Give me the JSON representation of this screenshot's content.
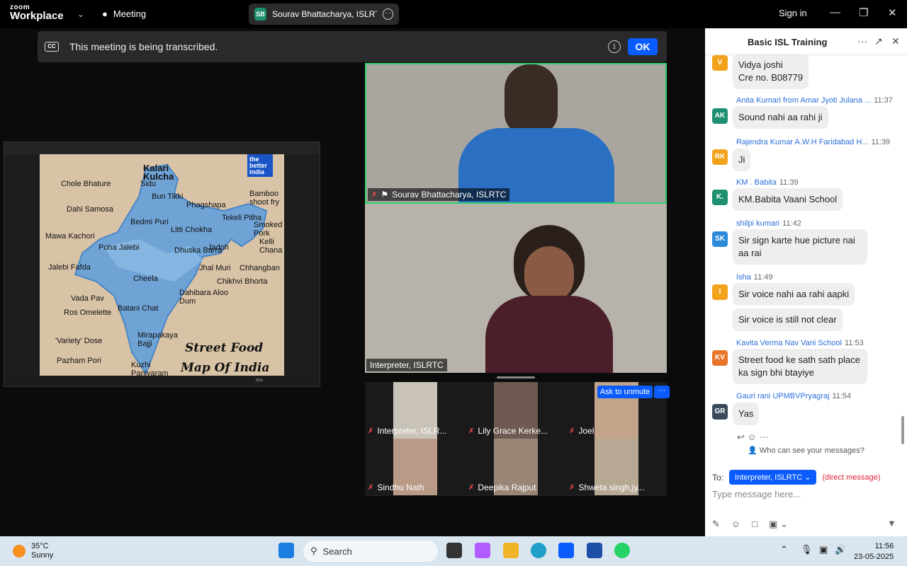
{
  "topbar": {
    "logo_top": "zoom",
    "logo_bottom": "Workplace",
    "meeting_label": "Meeting",
    "share_initials": "SB",
    "share_label": "Sourav Bhattacharya, ISLRTC's scr",
    "signin": "Sign in"
  },
  "banner": {
    "cc": "CC",
    "text": "This meeting is being transcribed.",
    "ok": "OK"
  },
  "shared_screen": {
    "brand": "the better india",
    "title_line1": "Street Food",
    "title_line2": "Map Of India",
    "labels": [
      "Kalari Kulcha",
      "Chole Bhature",
      "Sidu",
      "Bun Tikki",
      "Phagshapa",
      "Bamboo shoot fry",
      "Dahi Samosa",
      "Tekeli Pitha",
      "Smoked Pork",
      "Mawa Kachori",
      "Bedmi Puri",
      "Litti Chokha",
      "Kelli Chana",
      "Poha Jalebi",
      "Dhuska Barra",
      "Jadoh",
      "Jalebi Fafda",
      "Chhangban",
      "Jhal Muri",
      "Cheela",
      "Chikhvi Bhorta",
      "Dahibara Aloo Dum",
      "Vada Pav",
      "Batani Chat",
      "Ros Omelette",
      "Mirapakaya Bajji",
      "'Variety' Dose",
      "Pazham Pori",
      "Kuzhi Paniyaram"
    ],
    "zoom_pct": "55%"
  },
  "videos": {
    "main_top_name": "Sourav Bhattacharya, ISLRTC",
    "main_bottom_name": "Interpreter, ISLRTC"
  },
  "gallery": {
    "ask_unmute": "Ask to unmute",
    "more": "···",
    "tiles": [
      "Interpreter, ISLR...",
      "Lily Grace Kerke...",
      "Joel",
      "Sindhu Nath",
      "Deepika Rajput",
      "Shweta singh,jy..."
    ]
  },
  "chat": {
    "title": "Basic ISL Training",
    "messages": [
      {
        "initials": "V",
        "color": "#f2a31b",
        "sender": "",
        "time": "",
        "text": "Vidya joshi\nCre no. B08779"
      },
      {
        "initials": "AK",
        "color": "#1e8f6f",
        "sender": "Anita Kumari from Amar Jyoti Julana ...",
        "time": "11:37",
        "text": "Sound nahi aa rahi ji"
      },
      {
        "initials": "RK",
        "color": "#f2a31b",
        "sender": "Rajendra Kumar A.W.H Faridabad H...",
        "time": "11:39",
        "text": "Ji"
      },
      {
        "initials": "K.",
        "color": "#1e8f6f",
        "sender": "KM . Babita",
        "time": "11:39",
        "text": "KM.Babita Vaani School"
      },
      {
        "initials": "SK",
        "color": "#2b8ad9",
        "sender": "shilpi kumari",
        "time": "11:42",
        "text": "Sir sign karte hue picture nai aa rai"
      },
      {
        "initials": "I",
        "color": "#f2a31b",
        "sender": "Isha",
        "time": "11:49",
        "text": "Sir voice nahi aa rahi aapki"
      },
      {
        "initials": "",
        "color": "",
        "sender": "",
        "time": "",
        "text": "Sir voice is still not clear"
      },
      {
        "initials": "KV",
        "color": "#e8742a",
        "sender": "Kavita Verma Nav Vani School",
        "time": "11:53",
        "text": "Street food  ke sath sath place  ka sign bhi btayiye"
      },
      {
        "initials": "GR",
        "color": "#3b4a5a",
        "sender": "Gauri rani UPMBVPryagraj",
        "time": "11:54",
        "text": "Yas"
      }
    ],
    "who_can_see": "Who can see your messages?",
    "to_label": "To:",
    "to_recipient": "Interpreter, ISLRTC",
    "direct": "(direct message)",
    "placeholder": "Type message here..."
  },
  "taskbar": {
    "temp": "35°C",
    "weather": "Sunny",
    "search": "Search",
    "time": "11:56",
    "date": "23-05-2025"
  },
  "colors": {
    "accent": "#0b5cff",
    "active_speaker": "#2fd06f",
    "muted": "#ff4d4d"
  }
}
